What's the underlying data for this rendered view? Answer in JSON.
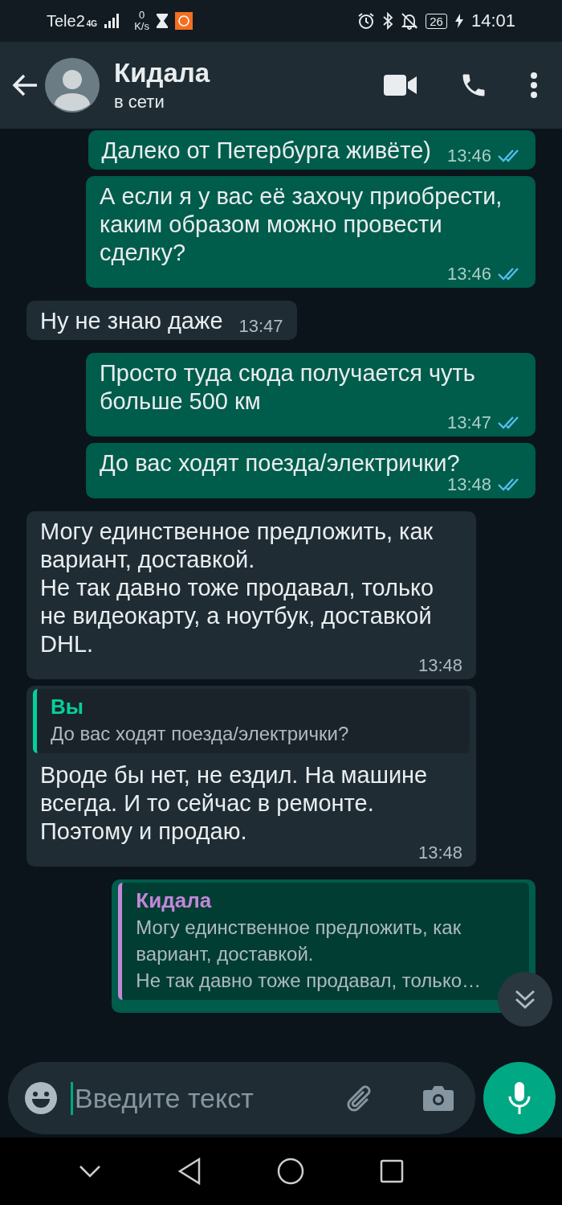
{
  "status_bar": {
    "carrier": "Tele2",
    "network": "4G",
    "speed_value": "0",
    "speed_unit": "K/s",
    "battery": "26",
    "time": "14:01"
  },
  "header": {
    "name": "Кидала",
    "status": "в сети"
  },
  "messages": [
    {
      "outgoing": true,
      "text": "Далеко от Петербурга живёте)",
      "time": "13:46",
      "read": true
    },
    {
      "outgoing": true,
      "text": "А если я у вас её захочу приобрести, каким образом можно провести сделку?",
      "time": "13:46",
      "read": true
    },
    {
      "outgoing": false,
      "text": "Ну не знаю даже",
      "time": "13:47"
    },
    {
      "outgoing": true,
      "text": "Просто туда сюда получается чуть больше 500 км",
      "time": "13:47",
      "read": true
    },
    {
      "outgoing": true,
      "text": "До вас ходят поезда/электрички?",
      "time": "13:48",
      "read": true
    },
    {
      "outgoing": false,
      "text": "Могу единственное предложить, как вариант, доставкой.\nНе так давно тоже продавал, только не видеокарту, а ноутбук, доставкой DHL.",
      "time": "13:48"
    },
    {
      "outgoing": false,
      "quote": {
        "sender": "Вы",
        "text": "До вас ходят поезда/электрички?",
        "color": "#06cf9c"
      },
      "text": "Вроде бы нет, не ездил. На машине всегда. И то сейчас в ремонте. Поэтому и продаю.",
      "time": "13:48"
    },
    {
      "outgoing": true,
      "quote": {
        "sender": "Кидала",
        "text": "Могу единственное предложить, как\nвариант, доставкой.\nНе так давно тоже продавал, только…",
        "color": "#c387d8"
      }
    }
  ],
  "composer": {
    "placeholder": "Введите текст"
  }
}
